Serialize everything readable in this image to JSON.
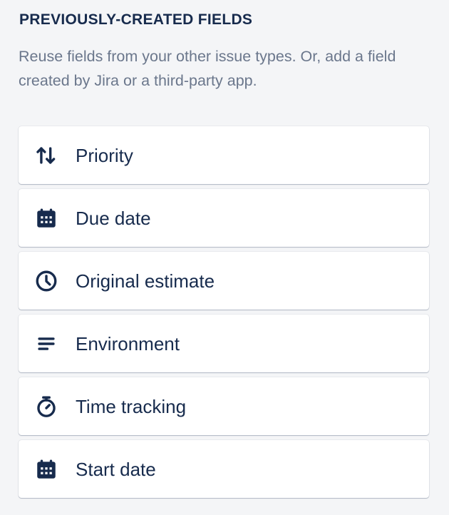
{
  "section": {
    "heading": "PREVIOUSLY-CREATED FIELDS",
    "description": "Reuse fields from your other issue types. Or, add a field created by Jira or a third-party app."
  },
  "fields": [
    {
      "label": "Priority",
      "icon": "priority-arrows-icon"
    },
    {
      "label": "Due date",
      "icon": "calendar-icon"
    },
    {
      "label": "Original estimate",
      "icon": "clock-icon"
    },
    {
      "label": "Environment",
      "icon": "text-lines-icon"
    },
    {
      "label": "Time tracking",
      "icon": "stopwatch-icon"
    },
    {
      "label": "Start date",
      "icon": "calendar-icon"
    }
  ],
  "colors": {
    "background": "#f4f5f7",
    "card": "#ffffff",
    "text": "#172b4d",
    "muted": "#6b778c"
  }
}
